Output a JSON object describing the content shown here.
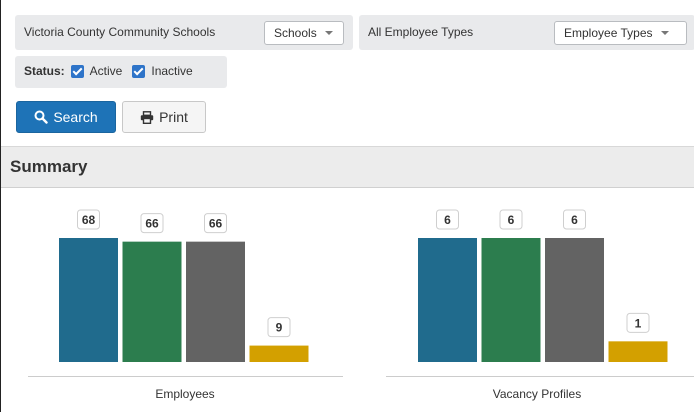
{
  "filters": {
    "district": "Victoria County Community Schools",
    "schools_select": "Schools",
    "employee_types_label": "All Employee Types",
    "employee_types_select": "Employee Types",
    "status_label": "Status:",
    "active_label": "Active",
    "inactive_label": "Inactive"
  },
  "actions": {
    "search_label": "Search",
    "print_label": "Print"
  },
  "summary": {
    "title": "Summary"
  },
  "colors": {
    "blue": "#206b8d",
    "green": "#2c7d4e",
    "gray": "#636363",
    "gold": "#d3a000"
  },
  "chart_data": [
    {
      "type": "bar",
      "title": "Employees",
      "categories": [
        "",
        "",
        "",
        ""
      ],
      "values": [
        68,
        66,
        66,
        9
      ],
      "ylim": [
        0,
        68
      ],
      "grid": false,
      "legend": "none"
    },
    {
      "type": "bar",
      "title": "Vacancy Profiles",
      "categories": [
        "",
        "",
        "",
        ""
      ],
      "values": [
        6,
        6,
        6,
        1
      ],
      "ylim": [
        0,
        6
      ],
      "grid": false,
      "legend": "none"
    }
  ]
}
